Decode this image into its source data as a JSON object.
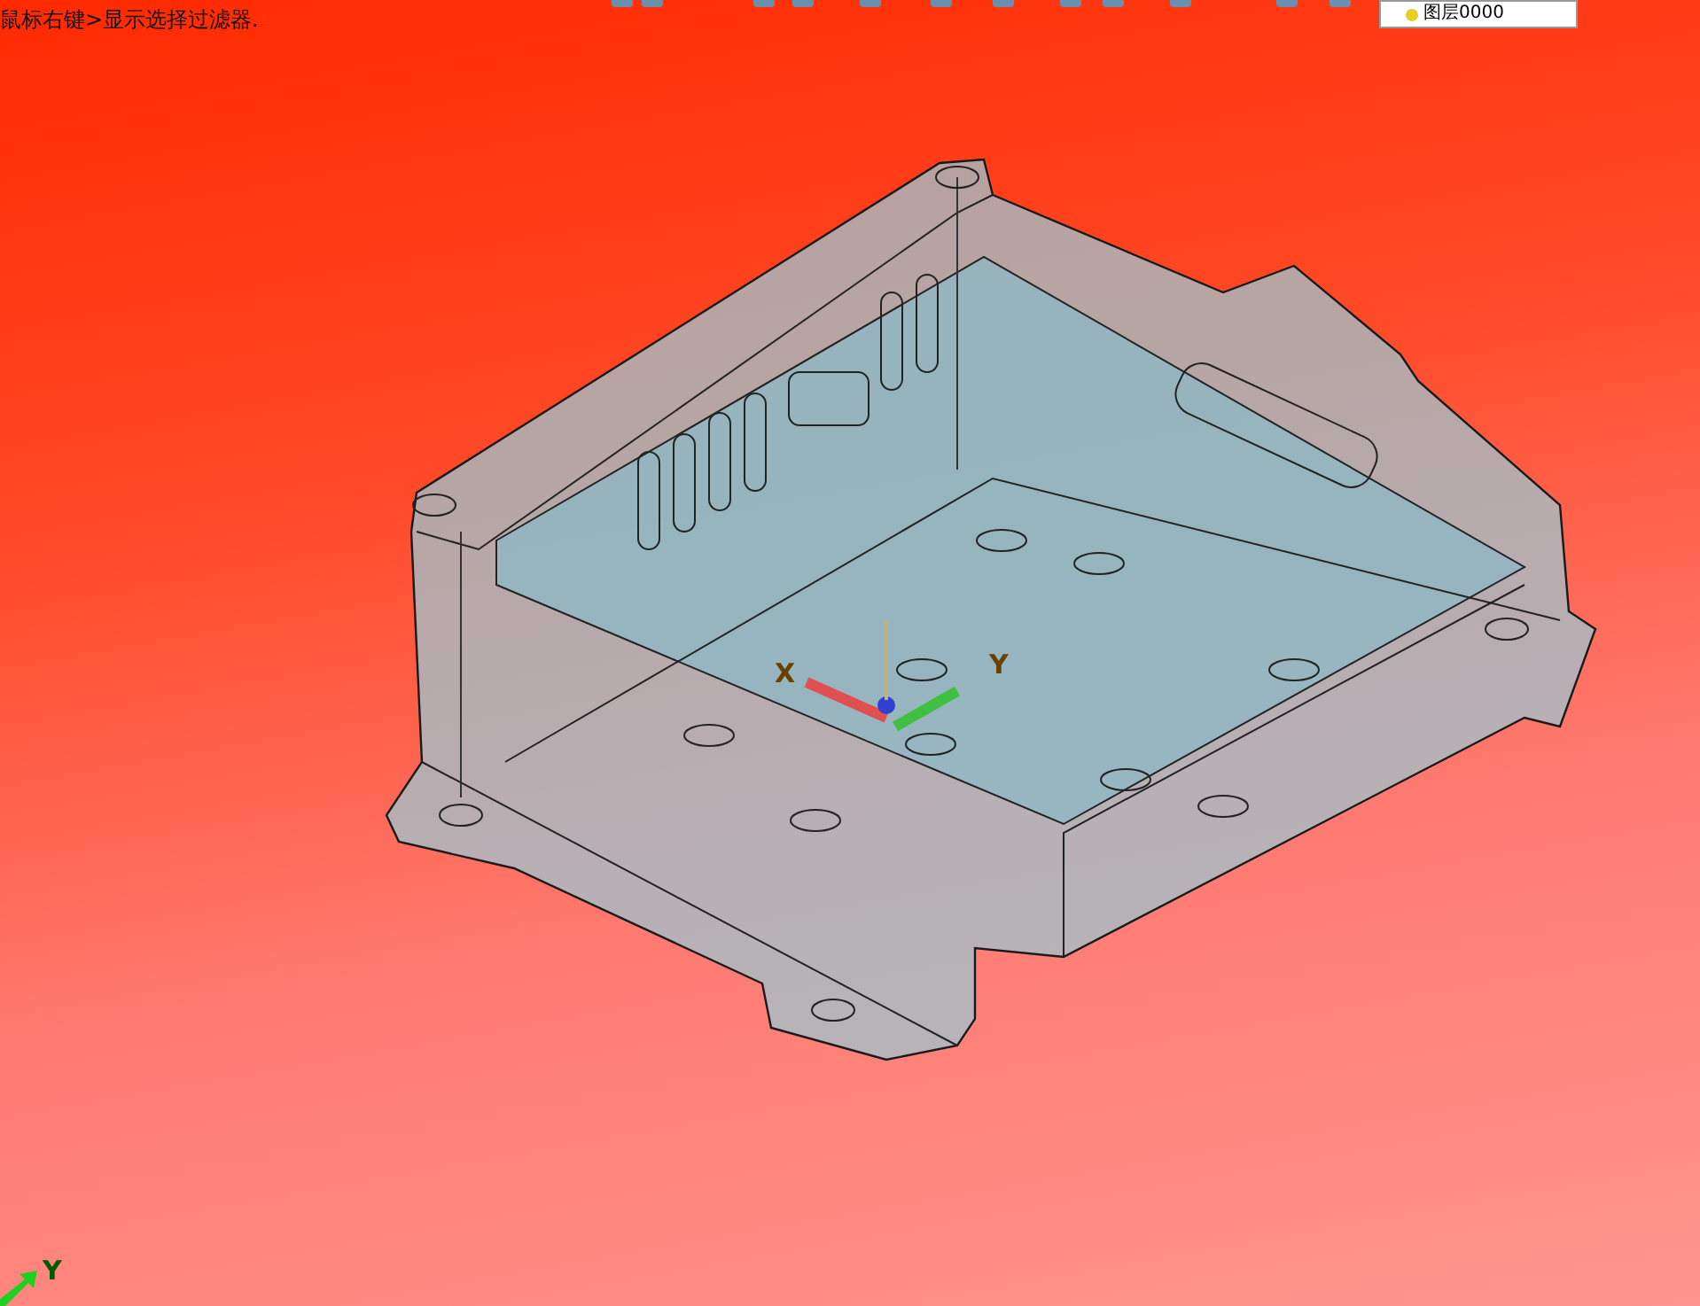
{
  "hints": [
    "鼠标右键>显示选择过滤器."
  ],
  "layer_field": {
    "value": "图层0000"
  },
  "triad": {
    "labels": [
      "X",
      "Y"
    ]
  },
  "corner_axis": {
    "label": "Y"
  }
}
